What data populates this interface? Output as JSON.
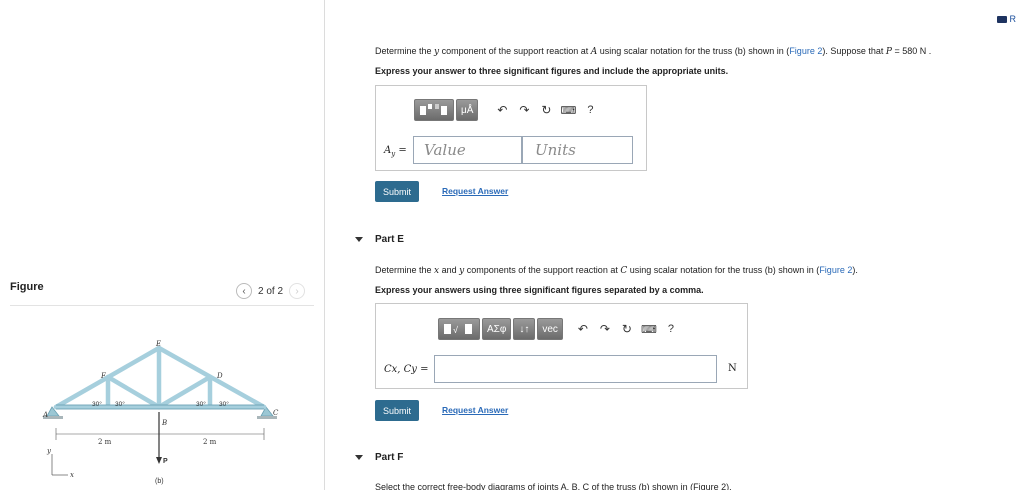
{
  "figure": {
    "title": "Figure",
    "pager_text": "2 of 2",
    "prev_icon": "chevron-left-icon",
    "next_icon": "chevron-right-icon",
    "labels": {
      "A": "A",
      "B": "B",
      "C": "C",
      "D": "D",
      "E": "E",
      "F": "F",
      "P": "P",
      "angle": "30°",
      "span": "2 m",
      "x": "x",
      "y": "y",
      "caption": "(b)"
    }
  },
  "header": {
    "book_icon": "book-icon",
    "book_text": "R"
  },
  "partD": {
    "prompt_pre": "Determine the ",
    "prompt_var": "y",
    "prompt_mid": " component of the support reaction at ",
    "prompt_point": "A",
    "prompt_post": " using scalar notation for the truss (b) shown in (",
    "figure_link": "Figure 2",
    "prompt_post2": "). Suppose that ",
    "p_var": "P",
    "p_value": " = 580  N .",
    "instruction": "Express your answer to three significant figures and include the appropriate units.",
    "answer_label": "A",
    "answer_sub": "y",
    "value_placeholder": "Value",
    "units_placeholder": "Units",
    "submit_label": "Submit",
    "request_label": "Request Answer",
    "tb_units": "μÅ",
    "tb_help": "?"
  },
  "partE": {
    "title": "Part E",
    "prompt_pre": "Determine the ",
    "x_var": "x",
    "prompt_and": " and ",
    "y_var": "y",
    "prompt_mid": " components of the support reaction at ",
    "point": "C",
    "prompt_post": " using scalar notation for the truss (b) shown in (",
    "figure_link": "Figure 2",
    "prompt_end": ").",
    "instruction": "Express your answers using three significant figures separated by a comma.",
    "answer_label": "Cx, Cy =",
    "unit": "N",
    "submit_label": "Submit",
    "request_label": "Request Answer",
    "tb_greek": "ΑΣφ",
    "tb_arrows": "↓↑",
    "tb_vec": "vec",
    "tb_help": "?"
  },
  "partF": {
    "title": "Part F",
    "prompt": "Select the correct free-body diagrams of joints A, B, C of the truss (b) shown in (Figure 2)."
  }
}
